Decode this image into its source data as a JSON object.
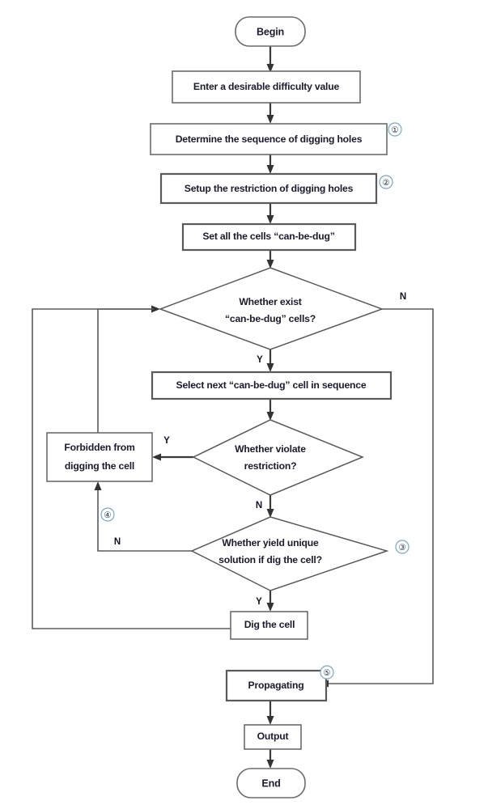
{
  "diagram": {
    "title": "Sudoku puzzle generation flowchart",
    "background": "#ffffff",
    "line_color": "#5c5c5c",
    "text_color": "#1b1b2e",
    "marker_color": "#7aa7c7"
  },
  "nodes": {
    "begin": {
      "label": "Begin",
      "type": "terminal"
    },
    "enter_difficulty": {
      "label": "Enter a desirable difficulty value",
      "type": "process"
    },
    "determine_sequence": {
      "label": "Determine the sequence of digging holes",
      "type": "process"
    },
    "setup_restriction": {
      "label": "Setup the restriction of digging holes",
      "type": "process"
    },
    "set_can_be_dug": {
      "label": "Set all the cells “can-be-dug”",
      "type": "process"
    },
    "whether_exist_line1": {
      "label": "Whether exist",
      "type": "decision"
    },
    "whether_exist_line2": {
      "label": "“can-be-dug” cells?",
      "type": "decision"
    },
    "select_next": {
      "label": "Select next “can-be-dug” cell in sequence",
      "type": "process"
    },
    "whether_violate_line1": {
      "label": "Whether violate",
      "type": "decision"
    },
    "whether_violate_line2": {
      "label": "restriction?",
      "type": "decision"
    },
    "forbidden_line1": {
      "label": "Forbidden from",
      "type": "process"
    },
    "forbidden_line2": {
      "label": "digging the cell",
      "type": "process"
    },
    "whether_unique_line1": {
      "label": "Whether yield unique",
      "type": "decision"
    },
    "whether_unique_line2": {
      "label": "solution if dig the cell?",
      "type": "decision"
    },
    "dig_the_cell": {
      "label": "Dig the cell",
      "type": "process"
    },
    "propagating": {
      "label": "Propagating",
      "type": "process"
    },
    "output": {
      "label": "Output",
      "type": "process"
    },
    "end": {
      "label": "End",
      "type": "terminal"
    }
  },
  "branch_labels": {
    "exist_no": "N",
    "exist_yes": "Y",
    "violate_yes": "Y",
    "violate_no": "N",
    "unique_no": "N",
    "unique_yes": "Y"
  },
  "markers": {
    "m1": "①",
    "m2": "②",
    "m3": "③",
    "m4": "④",
    "m5": "⑤"
  }
}
